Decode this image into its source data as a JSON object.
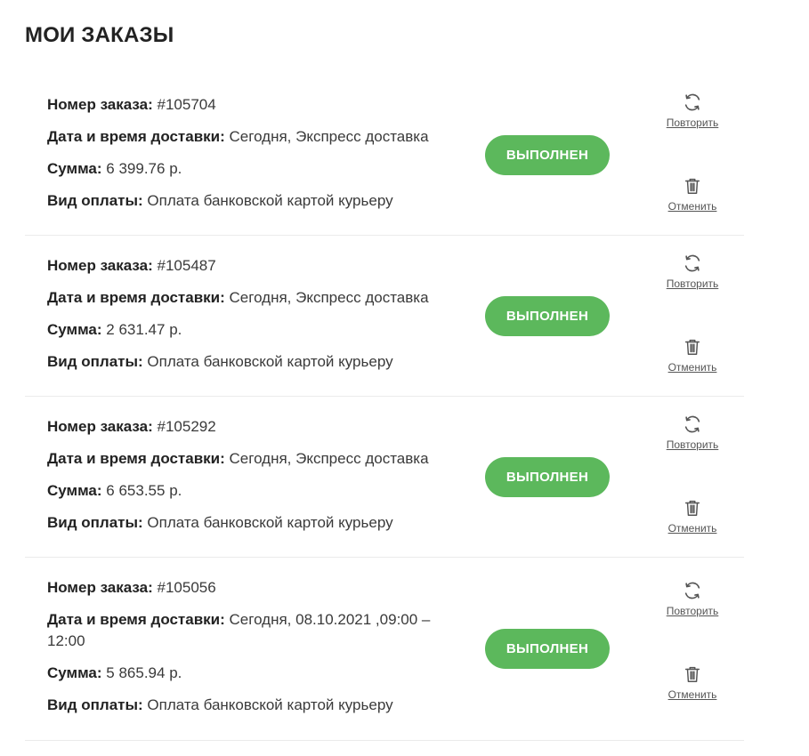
{
  "page_title": "МОИ ЗАКАЗЫ",
  "labels": {
    "order_number": "Номер заказа:",
    "delivery": "Дата и время доставки:",
    "sum": "Сумма:",
    "payment": "Вид оплаты:"
  },
  "orders": [
    {
      "number": "#105704",
      "delivery": "Сегодня, Экспресс доставка",
      "sum": "6 399.76 р.",
      "payment": "Оплата банковской картой курьеру",
      "status": "ВЫПОЛНЕН",
      "repeat_label": "Повторить",
      "cancel_label": "Отменить"
    },
    {
      "number": "#105487",
      "delivery": "Сегодня, Экспресс доставка",
      "sum": "2 631.47 р.",
      "payment": "Оплата банковской картой курьеру",
      "status": "ВЫПОЛНЕН",
      "repeat_label": "Повторить",
      "cancel_label": "Отменить"
    },
    {
      "number": "#105292",
      "delivery": "Сегодня, Экспресс доставка",
      "sum": "6 653.55 р.",
      "payment": "Оплата банковской картой курьеру",
      "status": "ВЫПОЛНЕН",
      "repeat_label": "Повторить",
      "cancel_label": "Отменить"
    },
    {
      "number": "#105056",
      "delivery": "Сегодня, 08.10.2021 ,09:00 – 12:00",
      "sum": "5 865.94 р.",
      "payment": "Оплата банковской картой курьеру",
      "status": "ВЫПОЛНЕН",
      "repeat_label": "Повторить",
      "cancel_label": "Отменить"
    }
  ],
  "icons": {
    "repeat": "refresh-icon",
    "cancel": "trash-icon"
  },
  "colors": {
    "status_badge": "#5cb85c",
    "text": "#2b2b2b",
    "divider": "#ebebeb"
  }
}
